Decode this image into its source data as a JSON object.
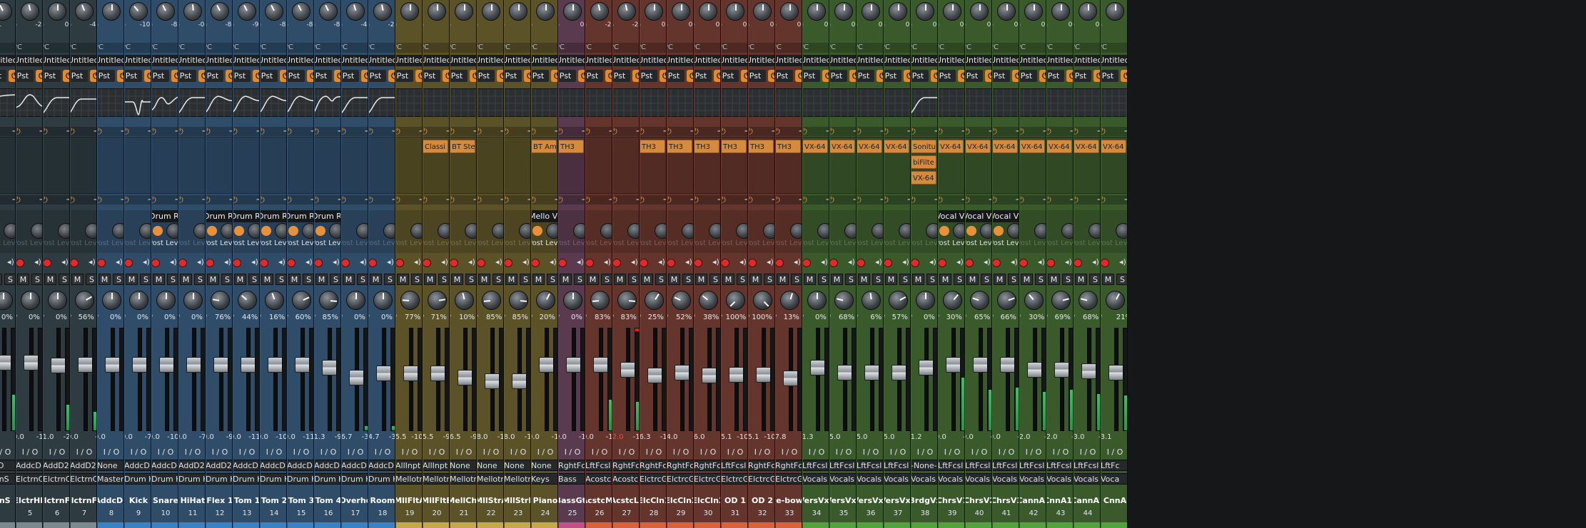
{
  "app": {
    "title": "Mixer"
  },
  "colors": {
    "gray": "#2e3b40",
    "blue": "#2f4d69",
    "olive": "#5b5228",
    "purple": "#5a3a4e",
    "red": "#64352c",
    "green": "#3b5a2c",
    "gray_bar": "#7c8a90",
    "blue_bar": "#3b82c4",
    "olive_bar": "#c4a84a",
    "purple_bar": "#c04f8a",
    "red_bar": "#d9623a",
    "green_bar": "#53a33c"
  },
  "labels": {
    "pc": "PC",
    "pst": "Pst",
    "post_level": "Post Level",
    "m": "M",
    "s": "S",
    "p": "P",
    "io": "I / O",
    "plus": "+",
    "power": "⏻",
    "monitor": "◂))"
  },
  "channels": [
    {
      "name": "rnS",
      "num": "",
      "color": "gray",
      "g": "-10.1",
      "gain_pct": 40,
      "plugin": "Untitlec",
      "eq": "lowshelf",
      "inserts": [],
      "send": "",
      "pan_val": "0% C",
      "pan_pct": 50,
      "fader_pct": 73,
      "peak_l": "-9",
      "peak_r": "",
      "meter_l": 35,
      "meter_r": 28,
      "clip": false,
      "in": "dcD",
      "out": "ctrnS"
    },
    {
      "name": "ElctrHH",
      "num": "5",
      "color": "gray",
      "g": "G",
      "gv": "-2.3",
      "gain_pct": 45,
      "plugin": "Untitlec",
      "eq": "bell",
      "inserts": [],
      "send": "",
      "pan_val": "0% C",
      "pan_pct": 50,
      "fader_pct": 73,
      "peak_l": "0.0",
      "peak_r": "-18",
      "meter_l": 0,
      "meter_r": 0,
      "clip": false,
      "in": "AddcD",
      "out": "ElctrnC"
    },
    {
      "name": "ElctrnF1",
      "num": "6",
      "color": "gray",
      "g": "G",
      "gv": "0.0",
      "gain_pct": 50,
      "plugin": "Untitlec",
      "eq": "hp",
      "inserts": [],
      "send": "",
      "pan_val": "0% C",
      "pan_pct": 50,
      "fader_pct": 70,
      "peak_l": "-1.0",
      "peak_r": "-22",
      "meter_l": 25,
      "meter_r": 20,
      "clip": false,
      "in": "AddD2",
      "out": "ElctrnC"
    },
    {
      "name": "ElctrnF2",
      "num": "7",
      "color": "gray",
      "g": "G",
      "gv": "-4.9",
      "gain_pct": 42,
      "plugin": "Untitlec",
      "eq": "hp2",
      "inserts": [],
      "send": "",
      "pan_val": "56% R",
      "pan_pct": 72,
      "fader_pct": 71,
      "peak_l": "0.0",
      "peak_r": "-8",
      "meter_l": 18,
      "meter_r": 32,
      "clip": false,
      "in": "AddD2",
      "out": "ElctrnC"
    },
    {
      "name": "AddcD2",
      "num": "8",
      "color": "blue",
      "g": "G",
      "gv": "0",
      "gain_pct": 50,
      "plugin": "Untitlec",
      "eq": "flat",
      "inserts": [],
      "send": "",
      "pan_val": "0% C",
      "pan_pct": 50,
      "fader_pct": 71,
      "peak_l": "0.0",
      "peak_r": "",
      "meter_l": 0,
      "meter_r": 0,
      "clip": false,
      "in": "None",
      "out": "Master"
    },
    {
      "name": "Kick",
      "num": "9",
      "color": "blue",
      "g": "G",
      "gv": "-10.6",
      "gain_pct": 35,
      "plugin": "Untitlec",
      "eq": "notch",
      "inserts": [],
      "send": "",
      "pan_val": "0% C",
      "pan_pct": 50,
      "fader_pct": 71,
      "peak_l": "0.0",
      "peak_r": "-74",
      "meter_l": 0,
      "meter_r": 0,
      "clip": false,
      "in": "AddcD",
      "out": "Drum K"
    },
    {
      "name": "Snare",
      "num": "10",
      "color": "blue",
      "g": "G",
      "gv": "-8.0",
      "gain_pct": 40,
      "plugin": "Untitlec",
      "eq": "snare",
      "inserts": [],
      "send": "Drum Rev",
      "pan_val": "0% C",
      "pan_pct": 50,
      "fader_pct": 71,
      "peak_l": "0.0",
      "peak_r": "-106",
      "meter_l": 0,
      "meter_r": 0,
      "clip": false,
      "in": "AddcD",
      "out": "Drum K"
    },
    {
      "name": "HiHat",
      "num": "11",
      "color": "blue",
      "g": "G",
      "gv": "-0.4",
      "gain_pct": 48,
      "plugin": "Untitlec",
      "eq": "hp",
      "inserts": [],
      "send": "",
      "pan_val": "0% C",
      "pan_pct": 50,
      "fader_pct": 71,
      "peak_l": "0.0",
      "peak_r": "-77",
      "meter_l": 0,
      "meter_r": 0,
      "clip": false,
      "in": "AddD2",
      "out": "Drum K"
    },
    {
      "name": "Flex 1",
      "num": "12",
      "color": "blue",
      "g": "G",
      "gv": "-8.9",
      "gain_pct": 40,
      "plugin": "Untitlec",
      "eq": "hump",
      "inserts": [],
      "send": "Drum Rev",
      "pan_val": "76% L",
      "pan_pct": 20,
      "fader_pct": 71,
      "peak_l": "0.0",
      "peak_r": "-96",
      "meter_l": 0,
      "meter_r": 0,
      "clip": false,
      "in": "AddD2",
      "out": "Drum K"
    },
    {
      "name": "Tom 1",
      "num": "13",
      "color": "blue",
      "g": "G",
      "gv": "-9.0",
      "gain_pct": 40,
      "plugin": "Untitlec",
      "eq": "hump",
      "inserts": [],
      "send": "Drum Rev",
      "pan_val": "44% L",
      "pan_pct": 32,
      "fader_pct": 71,
      "peak_l": "0.0",
      "peak_r": "-116",
      "meter_l": 0,
      "meter_r": 0,
      "clip": false,
      "in": "AddcD",
      "out": "Drum K"
    },
    {
      "name": "Tom 2",
      "num": "14",
      "color": "blue",
      "g": "G",
      "gv": "-8.6",
      "gain_pct": 40,
      "plugin": "Untitlec",
      "eq": "hump",
      "inserts": [],
      "send": "Drum Rev",
      "pan_val": "16% L",
      "pan_pct": 43,
      "fader_pct": 71,
      "peak_l": "0.0",
      "peak_r": "-103",
      "meter_l": 0,
      "meter_r": 0,
      "clip": false,
      "in": "AddcD",
      "out": "Drum K"
    },
    {
      "name": "Tom 3",
      "num": "15",
      "color": "blue",
      "g": "G",
      "gv": "-8.9",
      "gain_pct": 40,
      "plugin": "Untitlec",
      "eq": "hump",
      "inserts": [],
      "send": "Drum Rev",
      "pan_val": "60% R",
      "pan_pct": 74,
      "fader_pct": 71,
      "peak_l": "0.0",
      "peak_r": "-119",
      "meter_l": 0,
      "meter_r": 0,
      "clip": false,
      "in": "AddcD",
      "out": "Drum K"
    },
    {
      "name": "Tom 4",
      "num": "16",
      "color": "blue",
      "g": "G",
      "gv": "-8.7",
      "gain_pct": 40,
      "plugin": "Untitlec",
      "eq": "hump2",
      "inserts": [],
      "send": "Drum Rev",
      "pan_val": "85% R",
      "pan_pct": 85,
      "fader_pct": 68,
      "peak_l": "-1.3",
      "peak_r": "-96",
      "meter_l": 0,
      "meter_r": 0,
      "clip": false,
      "in": "AddcD",
      "out": "Drum K"
    },
    {
      "name": "Overhd",
      "num": "17",
      "color": "blue",
      "g": "G",
      "gv": "-4.1",
      "gain_pct": 44,
      "plugin": "Untitlec",
      "eq": "hp",
      "inserts": [],
      "send": "",
      "pan_val": "0% C",
      "pan_pct": 50,
      "fader_pct": 58,
      "peak_l": "-6.7",
      "peak_r": "-31",
      "meter_l": 4,
      "meter_r": 8,
      "clip": false,
      "in": "AddcD",
      "out": "Drum K"
    },
    {
      "name": "Room",
      "num": "18",
      "color": "blue",
      "g": "G",
      "gv": "-2.9",
      "gain_pct": 46,
      "plugin": "Untitlec",
      "eq": "hp",
      "inserts": [],
      "send": "",
      "pan_val": "0% C",
      "pan_pct": 50,
      "fader_pct": 62,
      "peak_l": "-4.7",
      "peak_r": "-32",
      "meter_l": 4,
      "meter_r": 3,
      "clip": false,
      "in": "AddcD",
      "out": "Drum K"
    },
    {
      "name": "MllFltA",
      "num": "19",
      "color": "olive",
      "g": "G",
      "gv": "0",
      "gain_pct": 50,
      "plugin": "Untitlec",
      "eq": "flat",
      "inserts": [],
      "send": "",
      "pan_val": "77% L",
      "pan_pct": 18,
      "fader_pct": 62,
      "peak_l": "-5.5",
      "peak_r": "-101",
      "meter_l": 0,
      "meter_r": 0,
      "clip": false,
      "in": "AllInpt",
      "out": "Mellotr"
    },
    {
      "name": "MllFltB",
      "num": "20",
      "color": "olive",
      "g": "G",
      "gv": "0",
      "gain_pct": 50,
      "plugin": "Untitlec",
      "eq": "flat",
      "inserts": [
        "Classi"
      ],
      "send": "",
      "pan_val": "71% R",
      "pan_pct": 80,
      "fader_pct": 62,
      "peak_l": "-5.5",
      "peak_r": "-94",
      "meter_l": 0,
      "meter_r": 0,
      "clip": false,
      "in": "AllInpt",
      "out": "Mellotr"
    },
    {
      "name": "MellChr",
      "num": "21",
      "color": "olive",
      "g": "G",
      "gv": "0",
      "gain_pct": 50,
      "plugin": "Untitlec",
      "eq": "flat",
      "inserts": [
        "BT Ste"
      ],
      "send": "",
      "pan_val": "10% L",
      "pan_pct": 45,
      "fader_pct": 58,
      "peak_l": "-6.5",
      "peak_r": "-91",
      "meter_l": 0,
      "meter_r": 0,
      "clip": false,
      "in": "None",
      "out": "Mellotr"
    },
    {
      "name": "MllStrA",
      "num": "22",
      "color": "olive",
      "g": "G",
      "gv": "0",
      "gain_pct": 50,
      "plugin": "Untitlec",
      "eq": "flat",
      "inserts": [],
      "send": "",
      "pan_val": "85% L",
      "pan_pct": 15,
      "fader_pct": 54,
      "peak_l": "-8.0",
      "peak_r": "-13",
      "meter_l": 0,
      "meter_r": 0,
      "clip": false,
      "in": "None",
      "out": "Mellotr"
    },
    {
      "name": "MllStrB",
      "num": "23",
      "color": "olive",
      "g": "G",
      "gv": "0",
      "gain_pct": 50,
      "plugin": "Untitlec",
      "eq": "flat",
      "inserts": [],
      "send": "",
      "pan_val": "85% R",
      "pan_pct": 85,
      "fader_pct": 54,
      "peak_l": "-8.0",
      "peak_r": "-13",
      "meter_l": 0,
      "meter_r": 0,
      "clip": false,
      "in": "None",
      "out": "Mellotr"
    },
    {
      "name": "Piano",
      "num": "24",
      "color": "olive",
      "g": "G",
      "gv": "0",
      "gain_pct": 50,
      "plugin": "Untitlec",
      "eq": "flat",
      "inserts": [
        "BT Am"
      ],
      "send": "Mello Ve",
      "pan_val": "20% R",
      "pan_pct": 60,
      "fader_pct": 71,
      "peak_l": "0.0",
      "peak_r": "-16",
      "meter_l": 0,
      "meter_r": 0,
      "clip": false,
      "in": "None",
      "out": "Keys"
    },
    {
      "name": "BassGtr",
      "num": "25",
      "color": "purple",
      "g": "G",
      "gv": "0.0",
      "gain_pct": 50,
      "plugin": "Untitlec",
      "eq": "flat",
      "inserts": [
        "TH3"
      ],
      "send": "",
      "pan_val": "0% C",
      "pan_pct": 50,
      "fader_pct": 71,
      "peak_l": "0.0",
      "peak_r": "-12",
      "meter_l": 0,
      "meter_r": 0,
      "clip": false,
      "in": "RghtFc",
      "out": "Bass"
    },
    {
      "name": "AcstcMc",
      "num": "26",
      "color": "red",
      "g": "G",
      "gv": "-2.2",
      "gain_pct": 45,
      "plugin": "Untitlec",
      "eq": "flat",
      "inserts": [],
      "send": "",
      "pan_val": "83% L",
      "pan_pct": 15,
      "fader_pct": 71,
      "peak_l": "0.0",
      "peak_r": "-13",
      "meter_l": 30,
      "meter_r": 22,
      "clip": false,
      "in": "LftFcsl",
      "out": "Acostc"
    },
    {
      "name": "AcstcLc",
      "num": "27",
      "color": "red",
      "g": "G",
      "gv": "-2.2",
      "gain_pct": 45,
      "plugin": "Untitlec",
      "eq": "flat",
      "inserts": [],
      "send": "",
      "pan_val": "83% R",
      "pan_pct": 85,
      "fader_pct": 66,
      "peak_l": "-2.0",
      "peak_r": "-14",
      "meter_l": 28,
      "meter_r": 20,
      "clip": true,
      "in": "RghtFc",
      "out": "Acostc"
    },
    {
      "name": "ElcCln1",
      "num": "28",
      "color": "red",
      "g": "G",
      "gv": "0.0",
      "gain_pct": 50,
      "plugin": "Untitlec",
      "eq": "flat",
      "inserts": [
        "TH3"
      ],
      "send": "",
      "pan_val": "25% R",
      "pan_pct": 62,
      "fader_pct": 60,
      "peak_l": "-6.3",
      "peak_r": "-10",
      "meter_l": 0,
      "meter_r": 0,
      "clip": false,
      "in": "RghtFc",
      "out": "ElctrcG"
    },
    {
      "name": "ElcCln2",
      "num": "29",
      "color": "red",
      "g": "G",
      "gv": "0.0",
      "gain_pct": 50,
      "plugin": "Untitlec",
      "eq": "flat",
      "inserts": [
        "TH3"
      ],
      "send": "",
      "pan_val": "52% L",
      "pan_pct": 26,
      "fader_pct": 63,
      "peak_l": "-4.0",
      "peak_r": "",
      "meter_l": 0,
      "meter_r": 0,
      "clip": false,
      "in": "RghtFc",
      "out": "ElctrcG"
    },
    {
      "name": "ElcCln3",
      "num": "30",
      "color": "red",
      "g": "G",
      "gv": "0.0",
      "gain_pct": 50,
      "plugin": "Untitlec",
      "eq": "flat",
      "inserts": [
        "TH3"
      ],
      "send": "",
      "pan_val": "38% L",
      "pan_pct": 31,
      "fader_pct": 60,
      "peak_l": "-6.0",
      "peak_r": "",
      "meter_l": 0,
      "meter_r": 0,
      "clip": false,
      "in": "RghtFc",
      "out": "ElctrcG"
    },
    {
      "name": "OD 1",
      "num": "31",
      "color": "red",
      "g": "G",
      "gv": "0.0",
      "gain_pct": 50,
      "plugin": "Untitlec",
      "eq": "flat",
      "inserts": [
        "TH3"
      ],
      "send": "",
      "pan_val": "100% L",
      "pan_pct": 0,
      "fader_pct": 61,
      "peak_l": "-5.1",
      "peak_r": "-101",
      "meter_l": 0,
      "meter_r": 0,
      "clip": false,
      "in": "LftFcsl",
      "out": "ElctrcG"
    },
    {
      "name": "OD 2",
      "num": "32",
      "color": "red",
      "g": "G",
      "gv": "0.0",
      "gain_pct": 50,
      "plugin": "Untitlec",
      "eq": "flat",
      "inserts": [
        "TH3"
      ],
      "send": "",
      "pan_val": "100% R",
      "pan_pct": 100,
      "fader_pct": 61,
      "peak_l": "-5.1",
      "peak_r": "-105",
      "meter_l": 0,
      "meter_r": 0,
      "clip": false,
      "in": "RghtFc",
      "out": "ElctrcG"
    },
    {
      "name": "e-bow",
      "num": "33",
      "color": "red",
      "g": "G",
      "gv": "0.0",
      "gain_pct": 50,
      "plugin": "Untitlec",
      "eq": "flat",
      "inserts": [
        "TH3"
      ],
      "send": "",
      "pan_val": "13% R",
      "pan_pct": 56,
      "fader_pct": 57,
      "peak_l": "-7.8",
      "peak_r": "",
      "meter_l": 0,
      "meter_r": 0,
      "clip": false,
      "in": "RghtFc",
      "out": "ElctrcG"
    },
    {
      "name": "VersVx1",
      "num": "34",
      "color": "green",
      "g": "G",
      "gv": "0.0",
      "gain_pct": 50,
      "plugin": "Untitlec",
      "eq": "flat",
      "inserts": [
        "VX-64"
      ],
      "send": "",
      "pan_val": "0% C",
      "pan_pct": 50,
      "fader_pct": 68,
      "peak_l": "-1.3",
      "peak_r": "",
      "meter_l": 0,
      "meter_r": 0,
      "clip": false,
      "in": "LftFcsl",
      "out": "Vocals"
    },
    {
      "name": "VersVx2",
      "num": "35",
      "color": "green",
      "g": "G",
      "gv": "0.0",
      "gain_pct": 50,
      "plugin": "Untitlec",
      "eq": "flat",
      "inserts": [
        "VX-64"
      ],
      "send": "",
      "pan_val": "68% L",
      "pan_pct": 22,
      "fader_pct": 63,
      "peak_l": "-5.0",
      "peak_r": "",
      "meter_l": 0,
      "meter_r": 0,
      "clip": false,
      "in": "LftFcsl",
      "out": "Vocals"
    },
    {
      "name": "VersVx3",
      "num": "36",
      "color": "green",
      "g": "G",
      "gv": "0.0",
      "gain_pct": 50,
      "plugin": "Untitlec",
      "eq": "flat",
      "inserts": [
        "VX-64"
      ],
      "send": "",
      "pan_val": "6% L",
      "pan_pct": 47,
      "fader_pct": 63,
      "peak_l": "-5.0",
      "peak_r": "",
      "meter_l": 0,
      "meter_r": 0,
      "clip": false,
      "in": "LftFcsl",
      "out": "Vocals"
    },
    {
      "name": "VersVx4",
      "num": "37",
      "color": "green",
      "g": "G",
      "gv": "0.0",
      "gain_pct": 50,
      "plugin": "Untitlec",
      "eq": "flat",
      "inserts": [
        "VX-64"
      ],
      "send": "",
      "pan_val": "57% R",
      "pan_pct": 73,
      "fader_pct": 63,
      "peak_l": "-5.0",
      "peak_r": "",
      "meter_l": 0,
      "meter_r": 0,
      "clip": false,
      "in": "LftFcsl",
      "out": "Vocals"
    },
    {
      "name": "BrdgVx",
      "num": "38",
      "color": "green",
      "g": "G",
      "gv": "0.0",
      "gain_pct": 50,
      "plugin": "Untitlec",
      "eq": "hp",
      "inserts": [
        "Sonitu",
        "biFilte",
        "VX-64"
      ],
      "send": "",
      "pan_val": "0% C",
      "pan_pct": 50,
      "fader_pct": 68,
      "peak_l": "-1.2",
      "peak_r": "",
      "meter_l": 0,
      "meter_r": 0,
      "clip": false,
      "in": "-None-",
      "out": "Vocals"
    },
    {
      "name": "ChrsV1",
      "num": "39",
      "color": "green",
      "g": "G",
      "gv": "0.0",
      "gain_pct": 50,
      "plugin": "Untitlec",
      "eq": "flat",
      "inserts": [
        "VX-64"
      ],
      "send": "Vocal Ve",
      "pan_val": "30% R",
      "pan_pct": 65,
      "fader_pct": 71,
      "peak_l": "0.0",
      "peak_r": "-5",
      "meter_l": 52,
      "meter_r": 58,
      "clip": false,
      "in": "LftFcsl",
      "out": "Vocals"
    },
    {
      "name": "ChrsV2",
      "num": "40",
      "color": "green",
      "g": "G",
      "gv": "0.0",
      "gain_pct": 50,
      "plugin": "Untitlec",
      "eq": "flat",
      "inserts": [
        "VX-64"
      ],
      "send": "Vocal Ve",
      "pan_val": "65% L",
      "pan_pct": 24,
      "fader_pct": 71,
      "peak_l": "0.0",
      "peak_r": "-9",
      "meter_l": 40,
      "meter_r": 44,
      "clip": false,
      "in": "LftFcsl",
      "out": "Vocals"
    },
    {
      "name": "ChrsV3",
      "num": "41",
      "color": "green",
      "g": "G",
      "gv": "0.0",
      "gain_pct": 50,
      "plugin": "Untitlec",
      "eq": "flat",
      "inserts": [
        "VX-64"
      ],
      "send": "Vocal Ve",
      "pan_val": "66% R",
      "pan_pct": 76,
      "fader_pct": 71,
      "peak_l": "0.0",
      "peak_r": "-9",
      "meter_l": 42,
      "meter_r": 46,
      "clip": false,
      "in": "LftFcsl",
      "out": "Vocals"
    },
    {
      "name": "CannA1",
      "num": "42",
      "color": "green",
      "g": "G",
      "gv": "0.0",
      "gain_pct": 50,
      "plugin": "Untitlec",
      "eq": "flat",
      "inserts": [
        "VX-64"
      ],
      "send": "",
      "pan_val": "30% L",
      "pan_pct": 35,
      "fader_pct": 66,
      "peak_l": "-2.0",
      "peak_r": "-6",
      "meter_l": 38,
      "meter_r": 46,
      "clip": false,
      "in": "LftFcsl",
      "out": "Vocals"
    },
    {
      "name": "CnnA1b",
      "num": "43",
      "color": "green",
      "g": "G",
      "gv": "0.0",
      "gain_pct": 50,
      "plugin": "Untitlec",
      "eq": "flat",
      "inserts": [
        "VX-64"
      ],
      "send": "",
      "pan_val": "69% R",
      "pan_pct": 78,
      "fader_pct": 66,
      "peak_l": "-2.0",
      "peak_r": "-7",
      "meter_l": 40,
      "meter_r": 44,
      "clip": false,
      "in": "LftFcsl",
      "out": "Vocals"
    },
    {
      "name": "CannA2",
      "num": "44",
      "color": "green",
      "g": "G",
      "gv": "0.0",
      "gain_pct": 50,
      "plugin": "Untitlec",
      "eq": "flat",
      "inserts": [
        "VX-64"
      ],
      "send": "",
      "pan_val": "68% L",
      "pan_pct": 22,
      "fader_pct": 64,
      "peak_l": "-3.0",
      "peak_r": "-7",
      "meter_l": 36,
      "meter_r": 42,
      "clip": false,
      "in": "LftFcsl",
      "out": "Vocals"
    },
    {
      "name": "CnnA",
      "num": "",
      "color": "green",
      "g": "G",
      "gv": "",
      "gain_pct": 50,
      "plugin": "Untitlec",
      "eq": "flat",
      "inserts": [
        "VX-64"
      ],
      "send": "",
      "pan_val": "21%",
      "pan_pct": 60,
      "fader_pct": 63,
      "peak_l": "-3.1",
      "peak_r": "",
      "meter_l": 34,
      "meter_r": 40,
      "clip": false,
      "in": "LftFc",
      "out": "Voca"
    }
  ]
}
